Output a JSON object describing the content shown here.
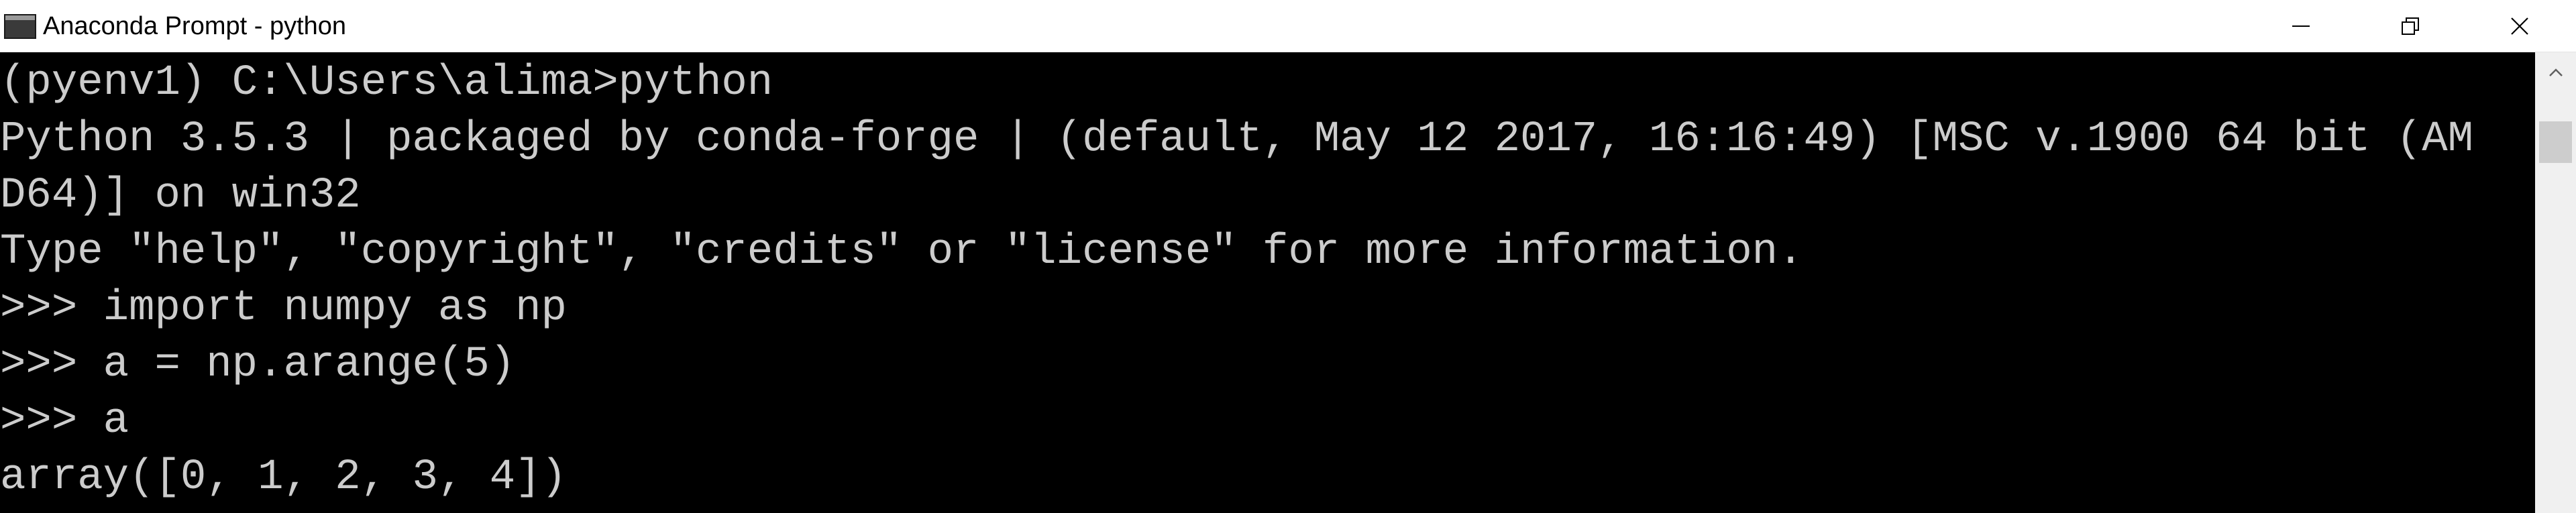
{
  "window": {
    "title": "Anaconda Prompt - python"
  },
  "titlebar": {
    "icon": "console-app-icon",
    "buttons": [
      {
        "name": "minimize",
        "icon": "minimize-icon"
      },
      {
        "name": "restore",
        "icon": "restore-icon"
      },
      {
        "name": "close",
        "icon": "close-icon"
      }
    ]
  },
  "console": {
    "background": "#000000",
    "foreground": "#cccccc",
    "lines": [
      "(pyenv1) C:\\Users\\alima>python",
      "Python 3.5.3 | packaged by conda-forge | (default, May 12 2017, 16:16:49) [MSC v.1900 64 bit (AM",
      "D64)] on win32",
      "Type \"help\", \"copyright\", \"credits\" or \"license\" for more information.",
      ">>> import numpy as np",
      ">>> a = np.arange(5)",
      ">>> a",
      "array([0, 1, 2, 3, 4])"
    ]
  },
  "scrollbar": {
    "up_icon": "scroll-up-arrow-icon",
    "thumb": "scroll-thumb"
  }
}
